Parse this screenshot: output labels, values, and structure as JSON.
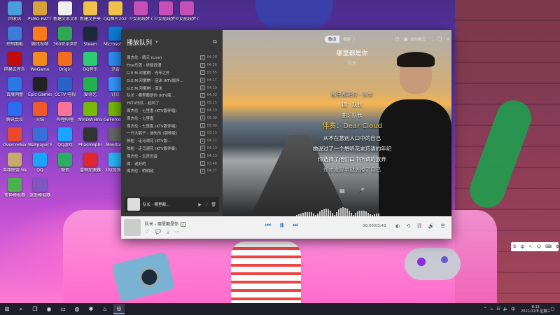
{
  "desktop_icons": [
    {
      "label": "回收站",
      "color": "#4a9edc"
    },
    {
      "label": "PUBG BATTLEGR...",
      "color": "#d8a23a"
    },
    {
      "label": "新建文本文档",
      "color": "#eeeeee"
    },
    {
      "label": "新建文件夹",
      "color": "#f0c24b"
    },
    {
      "label": "QQ图片20210624...",
      "color": "#f0c24b"
    },
    {
      "label": "少女前线梦 0212T120...",
      "color": "#c54fb7"
    },
    {
      "label": "少女前线梦 021411101...",
      "color": "#c54fb7"
    },
    {
      "label": "少女前线梦 021411101...",
      "color": "#c54fb7"
    },
    {
      "label": "控制面板",
      "color": "#3b7dd8"
    },
    {
      "label": "腾讯视频",
      "color": "#ff7a1a"
    },
    {
      "label": "360安全浏览器",
      "color": "#2fa84f"
    },
    {
      "label": "Steam",
      "color": "#1b2838"
    },
    {
      "label": "Microsoft Edge",
      "color": "#0b7bd4"
    },
    {
      "label": "网易云音乐",
      "color": "#c20c0c"
    },
    {
      "label": "WeGame",
      "color": "#f28b1a"
    },
    {
      "label": "Origin",
      "color": "#f26b1f"
    },
    {
      "label": "QQ音乐",
      "color": "#2ecc71"
    },
    {
      "label": "迅雷",
      "color": "#2d8cf0"
    },
    {
      "label": "百度网盘",
      "color": "#2b78e4"
    },
    {
      "label": "Epic Games",
      "color": "#222222"
    },
    {
      "label": "CCTV 电视",
      "color": "#2a62c9"
    },
    {
      "label": "爱奇艺",
      "color": "#22b14c"
    },
    {
      "label": "钉钉",
      "color": "#3296fa"
    },
    {
      "label": "腾讯会议",
      "color": "#2c6ef2"
    },
    {
      "label": "火绒",
      "color": "#f05a28"
    },
    {
      "label": "哔哩哔哩",
      "color": "#fb7299"
    },
    {
      "label": "NVIDIA Broadcast",
      "color": "#76b900"
    },
    {
      "label": "GeForce Experience",
      "color": "#76b900"
    },
    {
      "label": "Overcooked",
      "color": "#e84a2e"
    },
    {
      "label": "Wallpaper Engine",
      "color": "#3a6fd8"
    },
    {
      "label": "QQ游戏",
      "color": "#1aa3ff"
    },
    {
      "label": "Phasmophobia",
      "color": "#333333"
    },
    {
      "label": "Monitage",
      "color": "#666666"
    },
    {
      "label": "英雄联盟 WeGame版",
      "color": "#c8aa6e"
    },
    {
      "label": "QQ",
      "color": "#1aa3ff"
    },
    {
      "label": "微信",
      "color": "#2aae67"
    },
    {
      "label": "雷神加速器",
      "color": "#e0262f"
    },
    {
      "label": "UU加速器",
      "color": "#29b6f6"
    },
    {
      "label": "夜神模拟器",
      "color": "#4caf50"
    },
    {
      "label": "逍遥模拟器",
      "color": "#7e57c2"
    }
  ],
  "player": {
    "queue": {
      "title": "播放队列",
      "items": [
        {
          "title": "周杰伦 - 晴天 (Live)",
          "tag": "Z",
          "duration": "04:28"
        },
        {
          "title": "Fine乐团 - 终极浪漫",
          "tag": "Z",
          "duration": "04:56"
        },
        {
          "title": "G.E.M.邓紫棋 - 光年之外",
          "tag": "Z",
          "duration": "03:55"
        },
        {
          "title": "G.E.M.邓紫棋 - 泡沫 (KTV版伴...",
          "tag": "Z",
          "duration": "04:17"
        },
        {
          "title": "G.E.M.邓紫棋 - 泡沫",
          "tag": "Z",
          "duration": "04:19"
        },
        {
          "title": "队长 - 哪里都是你 (KTV版...",
          "tag": "Z",
          "duration": "04:03"
        },
        {
          "title": "YKTV乐队 - 起风了",
          "tag": "Z",
          "duration": "05:25"
        },
        {
          "title": "周杰伦 - 七里香 (KTV版伴唱)",
          "tag": "Z",
          "duration": "04:59"
        },
        {
          "title": "周杰伦 - 七里香",
          "tag": "Z",
          "duration": "05:00"
        },
        {
          "title": "周杰伦 - 七里香 (KTV版伴唱)",
          "tag": "Z",
          "duration": "05:00"
        },
        {
          "title": "一只大鹅子 - 迷失的 (钢琴版)",
          "tag": "Z",
          "duration": "03:15"
        },
        {
          "title": "陈粒 - 走马观花 (KTV版...",
          "tag": "Z",
          "duration": "04:11"
        },
        {
          "title": "陈粒 - 走马观花 (KTV版伴奏)",
          "tag": "Z",
          "duration": "04:13"
        },
        {
          "title": "周杰伦 - 云宫迅音",
          "tag": "Z",
          "duration": "04:13"
        },
        {
          "title": "周 - 说好的",
          "tag": "Z",
          "duration": "03:48"
        },
        {
          "title": "周杰伦 - 明明就",
          "tag": "Z",
          "duration": "04:27"
        }
      ],
      "now_playing": "队长 - 哪里都..."
    },
    "top": {
      "toggle_on": "歌词",
      "toggle_off": "视频",
      "mini_label": "迷你模式"
    },
    "lyrics": {
      "song_title": "哪里都是你",
      "artist": "队长",
      "lines": [
        {
          "text": "哪里都是你 - 队长",
          "style": "dim"
        },
        {
          "text": "词：队长",
          "style": "normal"
        },
        {
          "text": "曲：队长",
          "style": "normal"
        },
        {
          "text": "伴奏：Dear Cloud",
          "style": "cur"
        },
        {
          "text": "从不在意别人口中的自己",
          "style": "normal"
        },
        {
          "text": "她说过了一个想听花言巧语的年纪",
          "style": "normal"
        },
        {
          "text": "你选择了他们口中所谓的放弃",
          "style": "normal"
        },
        {
          "text": "却才发现早就丢掉了自己",
          "style": "dim"
        }
      ]
    },
    "bottom": {
      "song": "队长 - 哪里都是你",
      "quality_badge": "Z",
      "time": "00:00/03:43"
    }
  },
  "tray": {
    "ime": [
      "S",
      "中",
      "•,",
      "☺",
      "⌨",
      "⚙"
    ],
    "time": "8:13",
    "date": "2021/12/8 星期三"
  }
}
